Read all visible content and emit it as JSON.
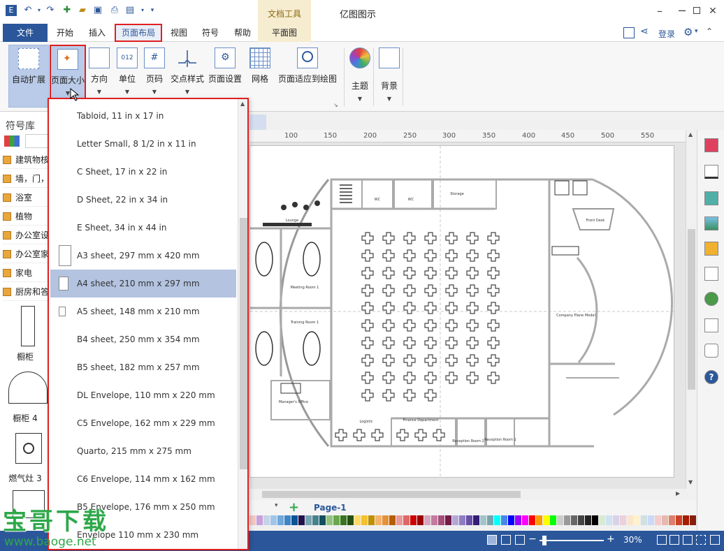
{
  "window": {
    "title": "亿图图示",
    "context_tab_group": "文档工具"
  },
  "menu": {
    "file": "文件",
    "tabs": [
      "开始",
      "插入",
      "页面布局",
      "视图",
      "符号",
      "帮助"
    ],
    "floorplan_tab": "平面图",
    "login": "登录"
  },
  "ribbon": {
    "buttons": [
      {
        "label": "自动扩展",
        "icon": "auto-expand-icon"
      },
      {
        "label": "页面大小",
        "icon": "page-size-icon"
      },
      {
        "label": "方向",
        "icon": "orientation-icon"
      },
      {
        "label": "单位",
        "icon": "unit-icon",
        "icon_text": "012"
      },
      {
        "label": "页码",
        "icon": "page-number-icon",
        "icon_text": "#"
      },
      {
        "label": "交点样式",
        "icon": "jump-style-icon"
      },
      {
        "label": "页面设置",
        "icon": "page-setup-icon"
      },
      {
        "label": "网格",
        "icon": "grid-icon"
      },
      {
        "label": "页面适应到绘图",
        "icon": "fit-to-drawing-icon"
      },
      {
        "label": "主题",
        "icon": "theme-icon"
      },
      {
        "label": "背景",
        "icon": "background-icon"
      }
    ]
  },
  "library": {
    "title": "符号库",
    "categories": [
      "建筑物核",
      "墙，门，",
      "浴室",
      "植物",
      "办公室设",
      "办公室家",
      "家电",
      "厨房和答"
    ],
    "shapes": [
      "橱柜",
      "橱柜 4",
      "燃气灶 3"
    ]
  },
  "ruler": {
    "ticks": [
      "100",
      "150",
      "200",
      "250",
      "300",
      "350",
      "400",
      "450",
      "500",
      "550"
    ]
  },
  "floorplan_labels": [
    "WC",
    "WC",
    "Storage",
    "Lounge",
    "Front Desk",
    "Meeting Room 1",
    "Training Room 1",
    "Company Plane Model",
    "Manager's Office",
    "Logistic",
    "Finance Department",
    "Reception Room 2",
    "Reception Room 1"
  ],
  "dropdown": {
    "items": [
      {
        "label": "Tabloid, 11 in x 17 in",
        "selected": false
      },
      {
        "label": "Letter Small, 8 1/2 in x 11 in",
        "selected": false
      },
      {
        "label": "C Sheet, 17 in x 22 in",
        "selected": false
      },
      {
        "label": "D Sheet, 22 in x 34 in",
        "selected": false
      },
      {
        "label": "E Sheet, 34 in x 44 in",
        "selected": false
      },
      {
        "label": "A3 sheet, 297 mm x 420 mm",
        "selected": false
      },
      {
        "label": "A4 sheet, 210 mm x 297 mm",
        "selected": true
      },
      {
        "label": "A5 sheet, 148 mm x 210 mm",
        "selected": false
      },
      {
        "label": "B4 sheet, 250 mm x 354 mm",
        "selected": false
      },
      {
        "label": "B5 sheet, 182 mm x 257 mm",
        "selected": false
      },
      {
        "label": "DL Envelope, 110 mm x 220 mm",
        "selected": false
      },
      {
        "label": "C5 Envelope, 162 mm x 229 mm",
        "selected": false
      },
      {
        "label": "Quarto, 215 mm x 275 mm",
        "selected": false
      },
      {
        "label": "C6 Envelope, 114 mm x 162 mm",
        "selected": false
      },
      {
        "label": "B5 Envelope, 176 mm x 250 mm",
        "selected": false
      },
      {
        "label": "Envelope 110 mm x 230 mm",
        "selected": false
      }
    ]
  },
  "pages": {
    "current": "Page-1",
    "add": "+"
  },
  "status": {
    "zoom": "30%",
    "zoom_minus": "−",
    "zoom_plus": "+"
  },
  "watermark": {
    "title": "宝哥下载",
    "url": "www.baoge.net"
  },
  "colors": {
    "accent": "#2b579a",
    "highlight_border": "#e02020",
    "selected_row": "#b3c3e0",
    "context_tab": "#f6ecd0"
  }
}
